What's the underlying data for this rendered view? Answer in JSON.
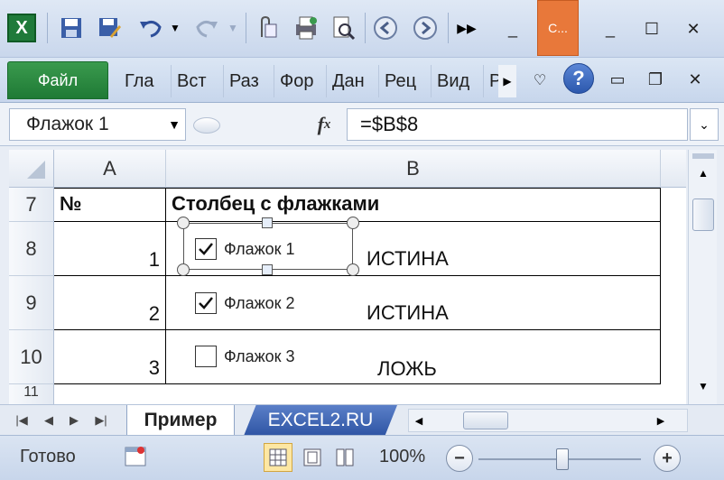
{
  "titlebar": {
    "app_title_tab": "С...",
    "minimize": "_",
    "restore": "☐",
    "close": "✕"
  },
  "ribbon": {
    "file_tab": "Файл",
    "tabs": [
      "Гла",
      "Вст",
      "Раз",
      "Фор",
      "Дан",
      "Рец",
      "Вид",
      "Р"
    ],
    "help": "?"
  },
  "formula_bar": {
    "name_box": "Флажок 1",
    "fx": "fx",
    "formula": "=$B$8"
  },
  "grid": {
    "columns": [
      "A",
      "B"
    ],
    "rows": [
      "7",
      "8",
      "9",
      "10",
      "11"
    ],
    "header_row": {
      "a": "№",
      "b": "Столбец с флажками"
    },
    "data_rows": [
      {
        "num": "1",
        "checkbox_label": "Флажок 1",
        "checked": true,
        "value": "ИСТИНА"
      },
      {
        "num": "2",
        "checkbox_label": "Флажок 2",
        "checked": true,
        "value": "ИСТИНА"
      },
      {
        "num": "3",
        "checkbox_label": "Флажок 3",
        "checked": false,
        "value": "ЛОЖЬ"
      }
    ]
  },
  "sheets": {
    "tabs": [
      "Пример",
      "EXCEL2.RU"
    ]
  },
  "status": {
    "ready": "Готово",
    "zoom": "100%",
    "zoom_minus": "−",
    "zoom_plus": "+"
  },
  "colors": {
    "accent_green": "#1f7a35",
    "title_orange": "#e8783a",
    "sheet_tab_blue": "#2f55a4"
  }
}
